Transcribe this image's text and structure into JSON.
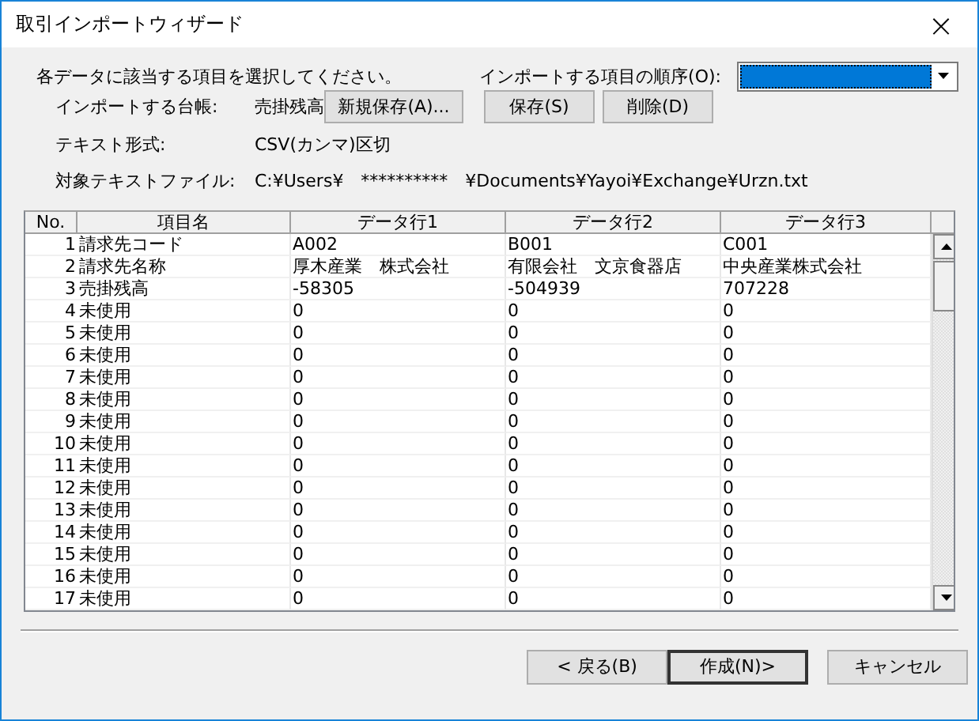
{
  "window": {
    "title": "取引インポートウィザード",
    "close": "×"
  },
  "instruction": "各データに該当する項目を選択してください。",
  "order": {
    "label": "インポートする項目の順序(O):",
    "focused": true
  },
  "info": [
    {
      "label": "インポートする台帳:",
      "value": "売掛残高"
    },
    {
      "label": "テキスト形式:",
      "value": "CSV(カンマ)区切"
    },
    {
      "label": "対象テキストファイル:",
      "value": "C:¥Users¥　**********　¥Documents¥Yayoi¥Exchange¥Urzn.txt"
    }
  ],
  "order_buttons": [
    "新規保存(A)...",
    "保存(S)",
    "削除(D)"
  ],
  "table": {
    "columns": [
      "No.",
      "項目名",
      "データ行1",
      "データ行2",
      "データ行3"
    ],
    "rows": [
      {
        "no": "1",
        "name": "請求先コード",
        "cells": [
          "A002",
          "B001",
          "C001"
        ]
      },
      {
        "no": "2",
        "name": "請求先名称",
        "cells": [
          "厚木産業　株式会社",
          "有限会社　文京食器店",
          "中央産業株式会社"
        ]
      },
      {
        "no": "3",
        "name": "売掛残高",
        "cells": [
          "-58305",
          "-504939",
          "707228"
        ]
      },
      {
        "no": "4",
        "name": "未使用",
        "cells": [
          "0",
          "0",
          "0"
        ]
      },
      {
        "no": "5",
        "name": "未使用",
        "cells": [
          "0",
          "0",
          "0"
        ]
      },
      {
        "no": "6",
        "name": "未使用",
        "cells": [
          "0",
          "0",
          "0"
        ]
      },
      {
        "no": "7",
        "name": "未使用",
        "cells": [
          "0",
          "0",
          "0"
        ]
      },
      {
        "no": "8",
        "name": "未使用",
        "cells": [
          "0",
          "0",
          "0"
        ]
      },
      {
        "no": "9",
        "name": "未使用",
        "cells": [
          "0",
          "0",
          "0"
        ]
      },
      {
        "no": "10",
        "name": "未使用",
        "cells": [
          "0",
          "0",
          "0"
        ]
      },
      {
        "no": "11",
        "name": "未使用",
        "cells": [
          "0",
          "0",
          "0"
        ]
      },
      {
        "no": "12",
        "name": "未使用",
        "cells": [
          "0",
          "0",
          "0"
        ]
      },
      {
        "no": "13",
        "name": "未使用",
        "cells": [
          "0",
          "0",
          "0"
        ]
      },
      {
        "no": "14",
        "name": "未使用",
        "cells": [
          "0",
          "0",
          "0"
        ]
      },
      {
        "no": "15",
        "name": "未使用",
        "cells": [
          "0",
          "0",
          "0"
        ]
      },
      {
        "no": "16",
        "name": "未使用",
        "cells": [
          "0",
          "0",
          "0"
        ]
      },
      {
        "no": "17",
        "name": "未使用",
        "cells": [
          "0",
          "0",
          "0"
        ]
      }
    ]
  },
  "buttons": [
    {
      "label": "< 戻る(B)",
      "default": false
    },
    {
      "label": "作成(N)>",
      "default": true
    },
    {
      "label": "キャンセル",
      "default": false
    }
  ]
}
